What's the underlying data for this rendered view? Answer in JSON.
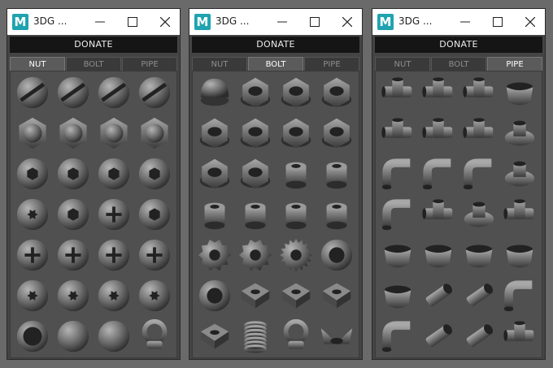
{
  "windows": [
    {
      "title": "3DG ...",
      "app_icon_letter": "M",
      "donate_label": "DONATE",
      "tabs": [
        "NUT",
        "BOLT",
        "PIPE"
      ],
      "active_tab": 0,
      "items": [
        "slotted-dome-head",
        "slotted-flat-head",
        "slotted-pan-head",
        "slotted-cheese-head",
        "hex-head-flat",
        "hex-head-domed",
        "hex-head-flange",
        "hex-head-washer",
        "hex-socket-cap",
        "hex-socket-dome",
        "hex-socket-flange",
        "hex-socket-button",
        "torx-flat-disc",
        "hex-drive-disc",
        "pozi-disc",
        "hex-recess-dome",
        "phillips-flat",
        "phillips-dome",
        "phillips-pan",
        "phillips-button",
        "torx-flat",
        "torx-dome",
        "torx-pan",
        "torx-button",
        "ring-cap",
        "half-sphere",
        "oval-plug",
        "eye-nut"
      ]
    },
    {
      "title": "3DG ...",
      "app_icon_letter": "M",
      "donate_label": "DONATE",
      "tabs": [
        "NUT",
        "BOLT",
        "PIPE"
      ],
      "active_tab": 1,
      "items": [
        "acorn-nut",
        "hex-nut-thick",
        "hex-nut",
        "hex-nut-flat",
        "hex-nut-chamfer",
        "hex-nut-wide",
        "flange-nut",
        "hex-nut-tall",
        "castle-nut",
        "hex-nut-large",
        "round-nut",
        "flanged-round-nut",
        "round-bushing",
        "tube-spacer",
        "tall-spacer",
        "round-cap-nut",
        "gear-washer",
        "toothed-washer",
        "serrated-lock-washer",
        "plain-washer",
        "ring-washer",
        "square-nut",
        "square-tab-nut",
        "square-washer",
        "cage-nut",
        "spring",
        "eye-bolt",
        "wing-nut"
      ]
    },
    {
      "title": "3DG ...",
      "app_icon_letter": "M",
      "donate_label": "DONATE",
      "tabs": [
        "NUT",
        "BOLT",
        "PIPE"
      ],
      "active_tab": 2,
      "items": [
        "pipe-tee",
        "pipe-cross",
        "pipe-cross-4way",
        "pipe-cap-flat",
        "pipe-tee-45",
        "pipe-cross-5way",
        "pipe-y",
        "pipe-flange-coupler",
        "pipe-elbow-90",
        "pipe-elbow-long",
        "pipe-elbow-wide",
        "pipe-floor-flange",
        "pipe-bend",
        "pipe-corner-3way",
        "pipe-wall-flange",
        "pipe-y-branch",
        "pipe-reducer-cup",
        "pipe-end-cap",
        "pipe-cup-short",
        "pipe-square-cap",
        "pipe-hex-plug",
        "pipe-straight",
        "pipe-threaded",
        "pipe-bend-45",
        "pipe-long-bend",
        "pipe-nipple",
        "pipe-union",
        "pipe-tee-small"
      ]
    }
  ]
}
